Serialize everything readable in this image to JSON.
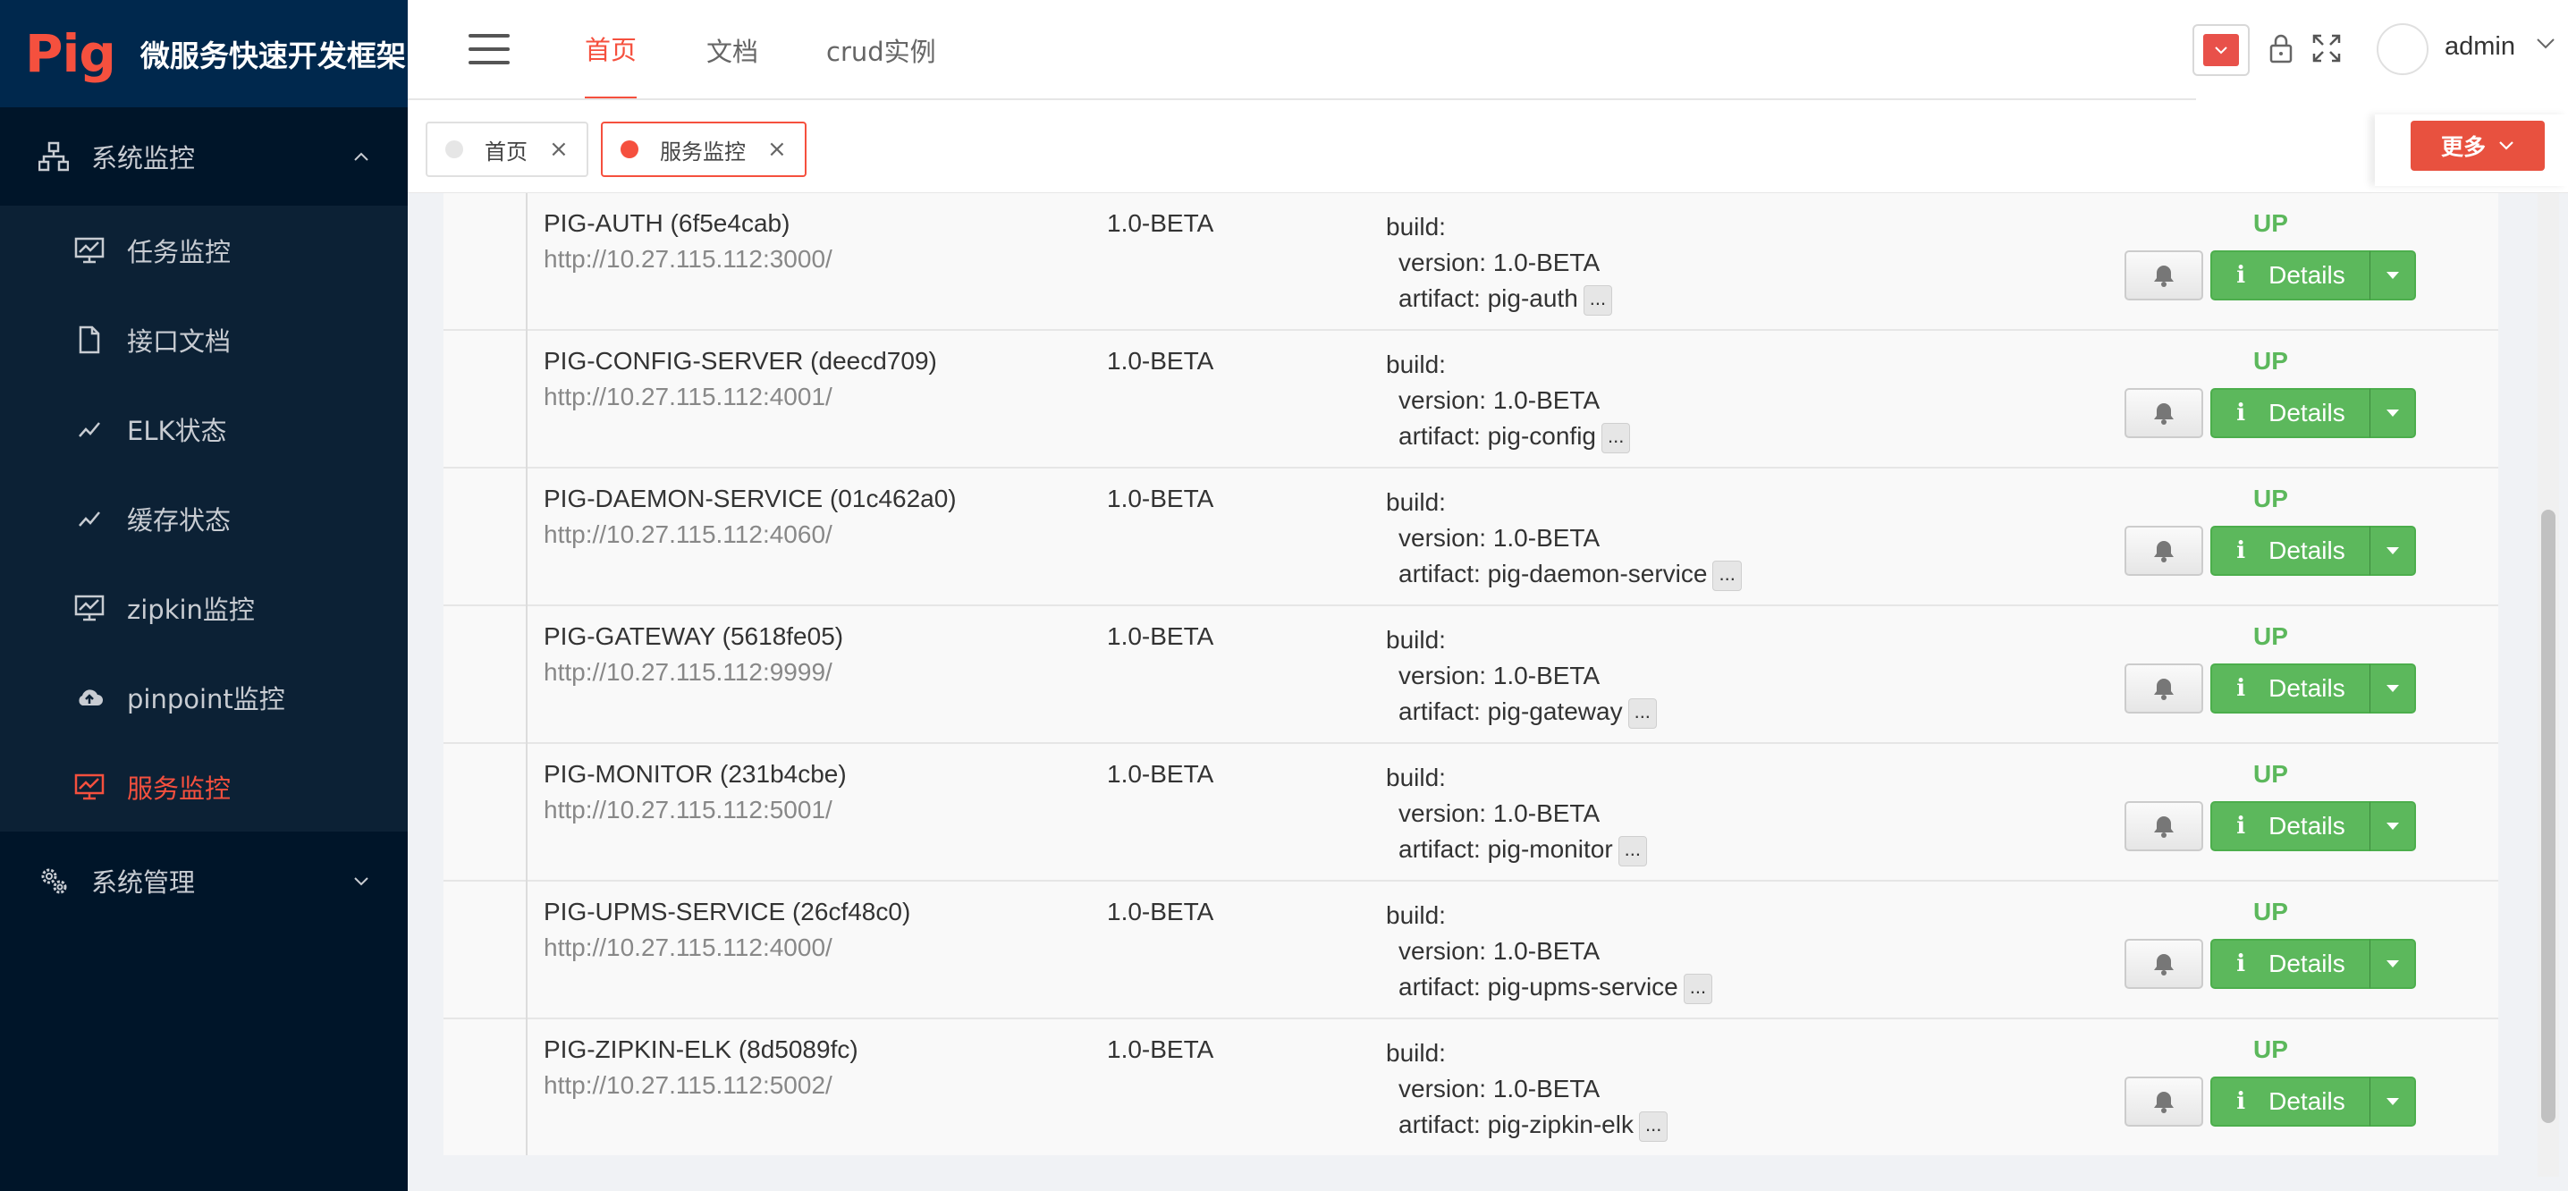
{
  "app": {
    "logo": "Pig",
    "title": "微服务快速开发框架"
  },
  "sidebar": {
    "groups": [
      {
        "label": "系统监控",
        "icon": "sitemap-icon",
        "expanded": true
      },
      {
        "label": "系统管理",
        "icon": "gears-icon",
        "expanded": false
      }
    ],
    "items": [
      {
        "label": "任务监控",
        "icon": "monitor-chart-icon"
      },
      {
        "label": "接口文档",
        "icon": "document-icon"
      },
      {
        "label": "ELK状态",
        "icon": "line-chart-icon"
      },
      {
        "label": "缓存状态",
        "icon": "line-chart-icon"
      },
      {
        "label": "zipkin监控",
        "icon": "monitor-chart-icon"
      },
      {
        "label": "pinpoint监控",
        "icon": "cloud-upload-icon"
      },
      {
        "label": "服务监控",
        "icon": "monitor-chart-icon",
        "active": true
      }
    ]
  },
  "header": {
    "tabs": [
      {
        "label": "首页",
        "active": true
      },
      {
        "label": "文档"
      },
      {
        "label": "crud实例"
      }
    ],
    "user": "admin",
    "theme_color": "#e8514a"
  },
  "tagbar": {
    "tags": [
      {
        "label": "首页",
        "dot_color": "#e6e6e6"
      },
      {
        "label": "服务监控",
        "dot_color": "#f5503e",
        "active": true
      }
    ],
    "more_label": "更多"
  },
  "services": [
    {
      "name": "PIG-AUTH (6f5e4cab)",
      "url": "http://10.27.115.112:3000/",
      "version": "1.0-BETA",
      "build_label": "build:",
      "build_version": "version: 1.0-BETA",
      "artifact": "artifact: pig-auth",
      "status": "UP"
    },
    {
      "name": "PIG-CONFIG-SERVER (deecd709)",
      "url": "http://10.27.115.112:4001/",
      "version": "1.0-BETA",
      "build_label": "build:",
      "build_version": "version: 1.0-BETA",
      "artifact": "artifact: pig-config",
      "status": "UP"
    },
    {
      "name": "PIG-DAEMON-SERVICE (01c462a0)",
      "url": "http://10.27.115.112:4060/",
      "version": "1.0-BETA",
      "build_label": "build:",
      "build_version": "version: 1.0-BETA",
      "artifact": "artifact: pig-daemon-service",
      "status": "UP"
    },
    {
      "name": "PIG-GATEWAY (5618fe05)",
      "url": "http://10.27.115.112:9999/",
      "version": "1.0-BETA",
      "build_label": "build:",
      "build_version": "version: 1.0-BETA",
      "artifact": "artifact: pig-gateway",
      "status": "UP"
    },
    {
      "name": "PIG-MONITOR (231b4cbe)",
      "url": "http://10.27.115.112:5001/",
      "version": "1.0-BETA",
      "build_label": "build:",
      "build_version": "version: 1.0-BETA",
      "artifact": "artifact: pig-monitor",
      "status": "UP"
    },
    {
      "name": "PIG-UPMS-SERVICE (26cf48c0)",
      "url": "http://10.27.115.112:4000/",
      "version": "1.0-BETA",
      "build_label": "build:",
      "build_version": "version: 1.0-BETA",
      "artifact": "artifact: pig-upms-service",
      "status": "UP"
    },
    {
      "name": "PIG-ZIPKIN-ELK (8d5089fc)",
      "url": "http://10.27.115.112:5002/",
      "version": "1.0-BETA",
      "build_label": "build:",
      "build_version": "version: 1.0-BETA",
      "artifact": "artifact: pig-zipkin-elk",
      "status": "UP"
    }
  ],
  "labels": {
    "details": "Details",
    "info_glyph": "i",
    "ellipsis": "..."
  },
  "colors": {
    "accent": "#f5503e",
    "sidebar_bg": "#001529",
    "status_up": "#5cb85c",
    "details_btn": "#5cb85c"
  }
}
